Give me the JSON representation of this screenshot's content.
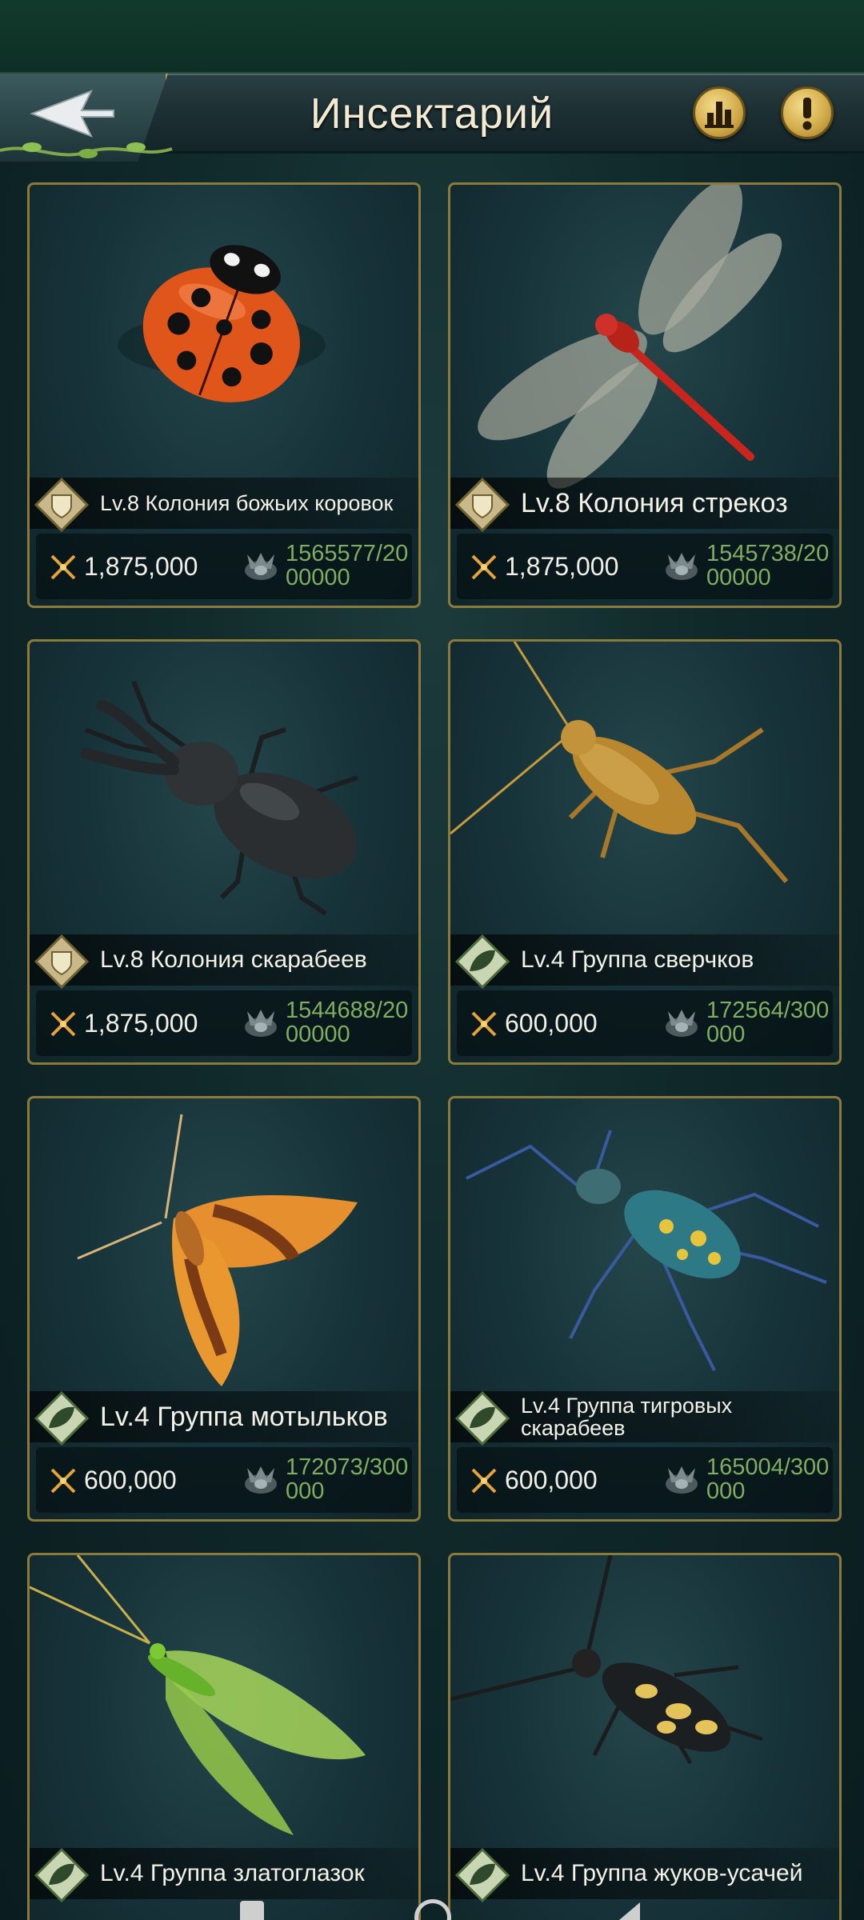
{
  "header": {
    "title": "Инсектарий",
    "back_icon": "back-arrow-icon",
    "stats_icon": "bar-chart-icon",
    "info_icon": "exclamation-icon"
  },
  "colors": {
    "frame_gold": "#8c7a3c",
    "resource_green": "#7fae62",
    "panel_bg": "#17333a"
  },
  "cards": [
    {
      "name": "Lv.8 Колония божьих коровок",
      "power": "1,875,000",
      "resources": "1565577/2000000",
      "insect": "ladybug",
      "badge": "shield-badge-icon"
    },
    {
      "name": "Lv.8 Колония стрекоз",
      "power": "1,875,000",
      "resources": "1545738/2000000",
      "insect": "dragonfly",
      "badge": "shield-badge-icon"
    },
    {
      "name": "Lv.8 Колония скарабеев",
      "power": "1,875,000",
      "resources": "1544688/2000000",
      "insect": "stag-beetle",
      "badge": "shield-badge-icon"
    },
    {
      "name": "Lv.4 Группа сверчков",
      "power": "600,000",
      "resources": "172564/300000",
      "insect": "cricket",
      "badge": "leaf-badge-icon"
    },
    {
      "name": "Lv.4 Группа мотыльков",
      "power": "600,000",
      "resources": "172073/300000",
      "insect": "moth",
      "badge": "leaf-badge-icon"
    },
    {
      "name": "Lv.4 Группа тигровых скарабеев",
      "power": "600,000",
      "resources": "165004/300000",
      "insect": "tiger-beetle",
      "badge": "leaf-badge-icon"
    },
    {
      "name": "Lv.4 Группа златоглазок",
      "power": "",
      "resources": "",
      "insect": "lacewing",
      "badge": "leaf-badge-icon"
    },
    {
      "name": "Lv.4 Группа жуков-усачей",
      "power": "",
      "resources": "",
      "insect": "longhorn-beetle",
      "badge": "leaf-badge-icon"
    }
  ]
}
